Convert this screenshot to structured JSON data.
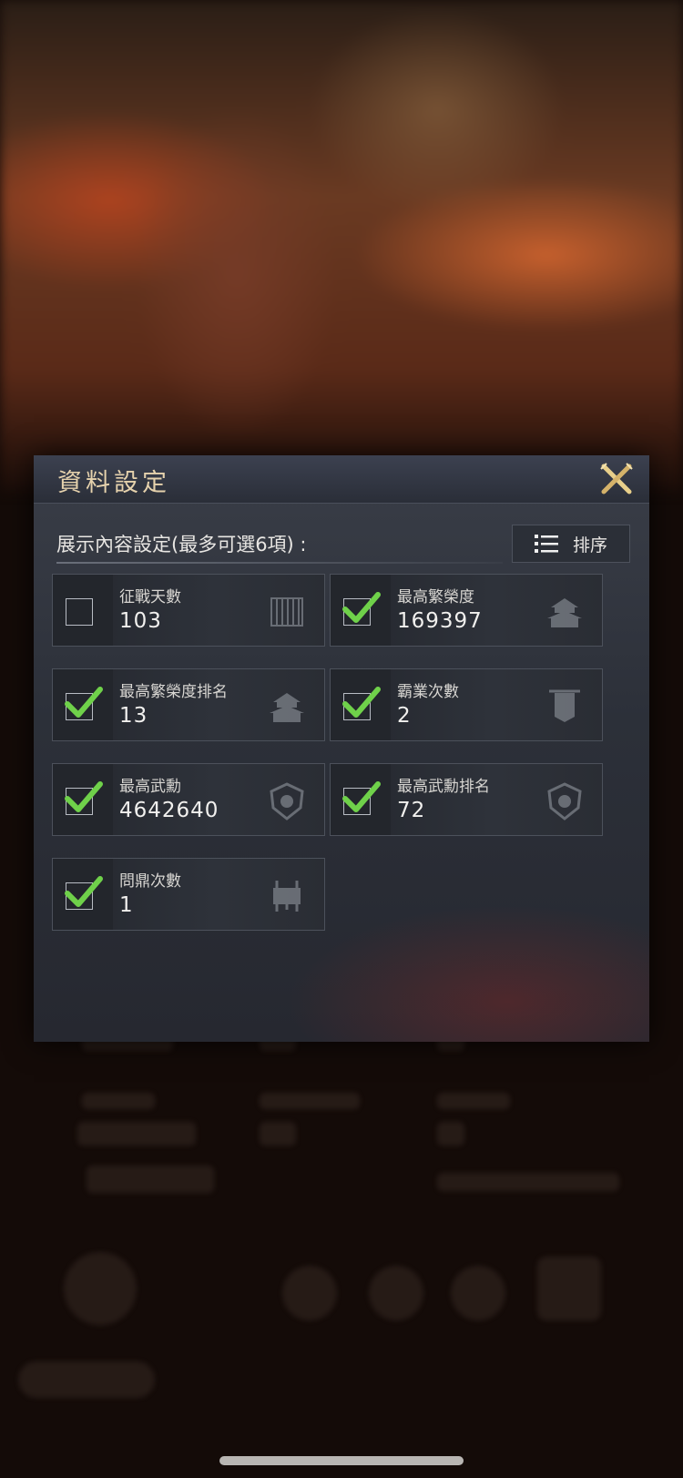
{
  "dialog": {
    "title": "資料設定",
    "section_label": "展示內容設定(最多可選6項) :",
    "sort_label": "排序"
  },
  "options": [
    {
      "label": "征戰天數",
      "value": "103",
      "checked": false,
      "icon": "book-icon"
    },
    {
      "label": "最高繁榮度",
      "value": "169397",
      "checked": true,
      "icon": "palace-icon"
    },
    {
      "label": "最高繁榮度排名",
      "value": "13",
      "checked": true,
      "icon": "palace-icon"
    },
    {
      "label": "霸業次數",
      "value": "2",
      "checked": true,
      "icon": "banner-icon"
    },
    {
      "label": "最高武勳",
      "value": "4642640",
      "checked": true,
      "icon": "shield-emblem-icon"
    },
    {
      "label": "最高武勳排名",
      "value": "72",
      "checked": true,
      "icon": "shield-emblem-icon"
    },
    {
      "label": "問鼎次數",
      "value": "1",
      "checked": true,
      "icon": "cauldron-icon"
    }
  ],
  "colors": {
    "accent_gold": "#e6d2ad",
    "check_green": "#6fd14a"
  }
}
